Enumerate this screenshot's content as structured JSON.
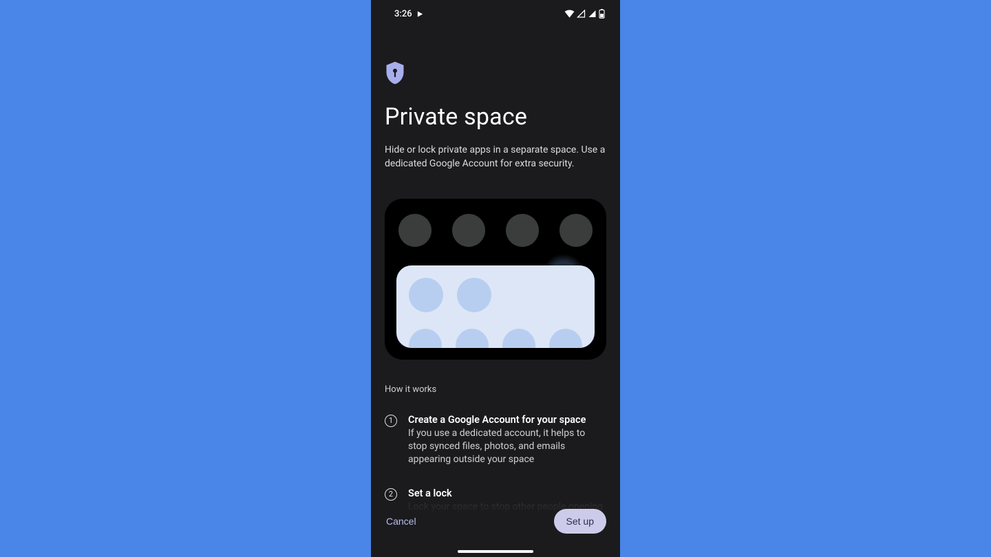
{
  "statusbar": {
    "time": "3:26"
  },
  "header": {
    "title": "Private space",
    "subtitle": "Hide or lock private apps in a separate space. Use a dedicated Google Account for extra security."
  },
  "how_it_works_label": "How it works",
  "steps": [
    {
      "num": "1",
      "title": "Create a Google Account for your space",
      "desc": "If you use a dedicated account, it helps to stop synced files, photos, and emails appearing outside your space"
    },
    {
      "num": "2",
      "title": "Set a lock",
      "desc": "Lock your space to stop other people opening it"
    }
  ],
  "footer": {
    "cancel": "Cancel",
    "setup": "Set up"
  },
  "colors": {
    "accent_button_bg": "#ccccea",
    "accent_text": "#b8bdf0",
    "shield_fill": "#a7aeec"
  }
}
